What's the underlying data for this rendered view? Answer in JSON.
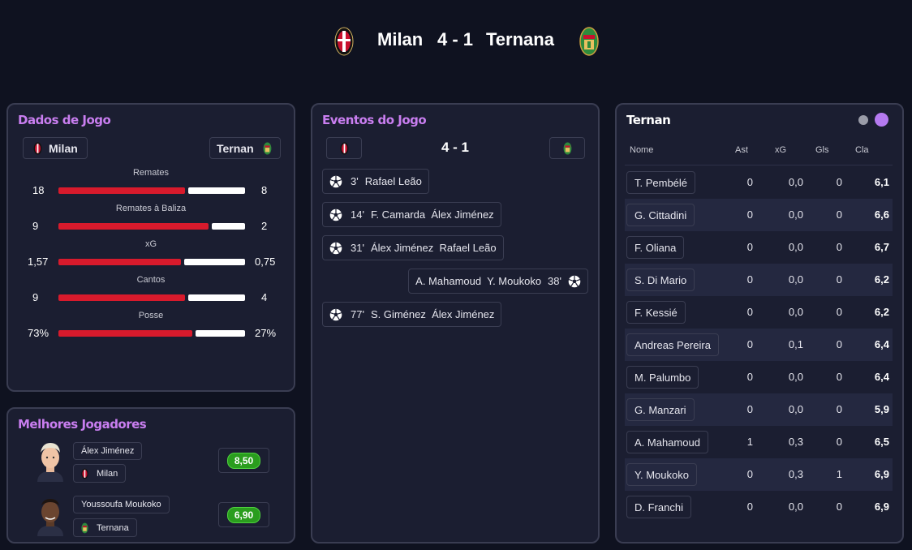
{
  "header": {
    "home_team": "Milan",
    "score": "4 - 1",
    "away_team": "Ternana",
    "home_crest_icon": "milan-crest-icon",
    "away_crest_icon": "ternana-crest-icon"
  },
  "colors": {
    "background": "#0f1220",
    "panel": "#1b1e31",
    "title_accent": "#c97ef0",
    "home_bar": "#d81a2c",
    "away_bar": "#ffffff",
    "rating_green": "#2a9d1e",
    "toggle_active": "#b57af0",
    "toggle_inactive": "#9a9ca8"
  },
  "stats_panel": {
    "title": "Dados de Jogo",
    "home_label": "Milan",
    "away_label": "Ternan",
    "stats": [
      {
        "label": "Remates",
        "home": "18",
        "away": "8",
        "home_share": 0.69
      },
      {
        "label": "Remates à Baliza",
        "home": "9",
        "away": "2",
        "home_share": 0.82
      },
      {
        "label": "xG",
        "home": "1,57",
        "away": "0,75",
        "home_share": 0.67
      },
      {
        "label": "Cantos",
        "home": "9",
        "away": "4",
        "home_share": 0.69
      },
      {
        "label": "Posse",
        "home": "73%",
        "away": "27%",
        "home_share": 0.73
      }
    ]
  },
  "best_players": {
    "title": "Melhores Jogadores",
    "players": [
      {
        "name": "Álex Jiménez",
        "team": "Milan",
        "rating": "8,50",
        "avatar_icon": "player-avatar-icon"
      },
      {
        "name": "Youssoufa Moukoko",
        "team": "Ternana",
        "rating": "6,90",
        "avatar_icon": "player-avatar-icon"
      }
    ]
  },
  "events_panel": {
    "title": "Eventos do Jogo",
    "score": "4 - 1",
    "events": [
      {
        "minute": "3'",
        "players": "Rafael Leão",
        "side": "home",
        "icon": "football-icon"
      },
      {
        "minute": "14'",
        "players": "F. Camarda  Álex Jiménez",
        "side": "home",
        "icon": "football-icon"
      },
      {
        "minute": "31'",
        "players": "Álex Jiménez  Rafael Leão",
        "side": "home",
        "icon": "football-icon"
      },
      {
        "minute": "38'",
        "players": "A. Mahamoud  Y. Moukoko",
        "side": "away",
        "icon": "football-icon"
      },
      {
        "minute": "77'",
        "players": "S. Giménez  Álex Jiménez",
        "side": "home",
        "icon": "football-icon"
      }
    ]
  },
  "team_table": {
    "title": "Ternan",
    "columns": [
      "Nome",
      "Ast",
      "xG",
      "Gls",
      "Cla"
    ],
    "rows": [
      [
        "T. Pembélé",
        "0",
        "0,0",
        "0",
        "6,1"
      ],
      [
        "G. Cittadini",
        "0",
        "0,0",
        "0",
        "6,6"
      ],
      [
        "F. Oliana",
        "0",
        "0,0",
        "0",
        "6,7"
      ],
      [
        "S. Di Mario",
        "0",
        "0,0",
        "0",
        "6,2"
      ],
      [
        "F. Kessié",
        "0",
        "0,0",
        "0",
        "6,2"
      ],
      [
        "Andreas Pereira",
        "0",
        "0,1",
        "0",
        "6,4"
      ],
      [
        "M. Palumbo",
        "0",
        "0,0",
        "0",
        "6,4"
      ],
      [
        "G. Manzari",
        "0",
        "0,0",
        "0",
        "5,9"
      ],
      [
        "A. Mahamoud",
        "1",
        "0,3",
        "0",
        "6,5"
      ],
      [
        "Y. Moukoko",
        "0",
        "0,3",
        "1",
        "6,9"
      ],
      [
        "D. Franchi",
        "0",
        "0,0",
        "0",
        "6,9"
      ]
    ]
  }
}
